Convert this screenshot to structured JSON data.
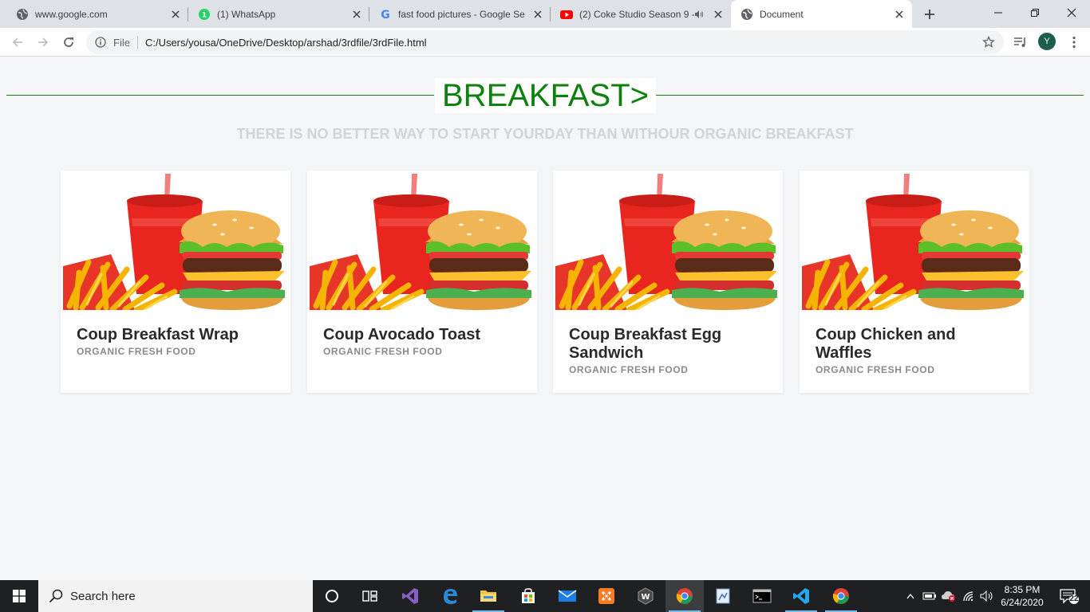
{
  "browser": {
    "tabs": [
      {
        "title": "www.google.com",
        "icon": "globe-icon",
        "active": false
      },
      {
        "title": "(1) WhatsApp",
        "icon": "whatsapp-icon",
        "active": false
      },
      {
        "title": "fast food pictures - Google Sea",
        "icon": "google-icon",
        "active": false
      },
      {
        "title": "(2) Coke Studio Season 9 -",
        "icon": "youtube-icon",
        "active": false
      },
      {
        "title": "Document",
        "icon": "globe-icon",
        "active": true
      }
    ],
    "address_bar": {
      "scheme_label": "File",
      "url": "C:/Users/yousa/OneDrive/Desktop/arshad/3rdfile/3rdFile.html"
    },
    "profile_initial": "Y"
  },
  "page": {
    "heading": "BREAKFAST>",
    "subheading": "THERE IS NO BETTER WAY TO START YOURDAY THAN WITHOUR ORGANIC BREAKFAST",
    "cards": [
      {
        "title": "Coup Breakfast Wrap",
        "subtitle": "ORGANIC FRESH FOOD"
      },
      {
        "title": "Coup Avocado Toast",
        "subtitle": "ORGANIC FRESH FOOD"
      },
      {
        "title": "Coup Breakfast Egg Sandwich",
        "subtitle": "ORGANIC FRESH FOOD"
      },
      {
        "title": "Coup Chicken and Waffles",
        "subtitle": "ORGANIC FRESH FOOD"
      }
    ]
  },
  "taskbar": {
    "search_placeholder": "Search here",
    "clock_time": "8:35 PM",
    "clock_date": "6/24/2020",
    "notification_count": "22"
  },
  "colors": {
    "heading_green": "#0e800e",
    "page_bg": "#f4f5f7",
    "taskbar_bg": "#1f2021"
  }
}
